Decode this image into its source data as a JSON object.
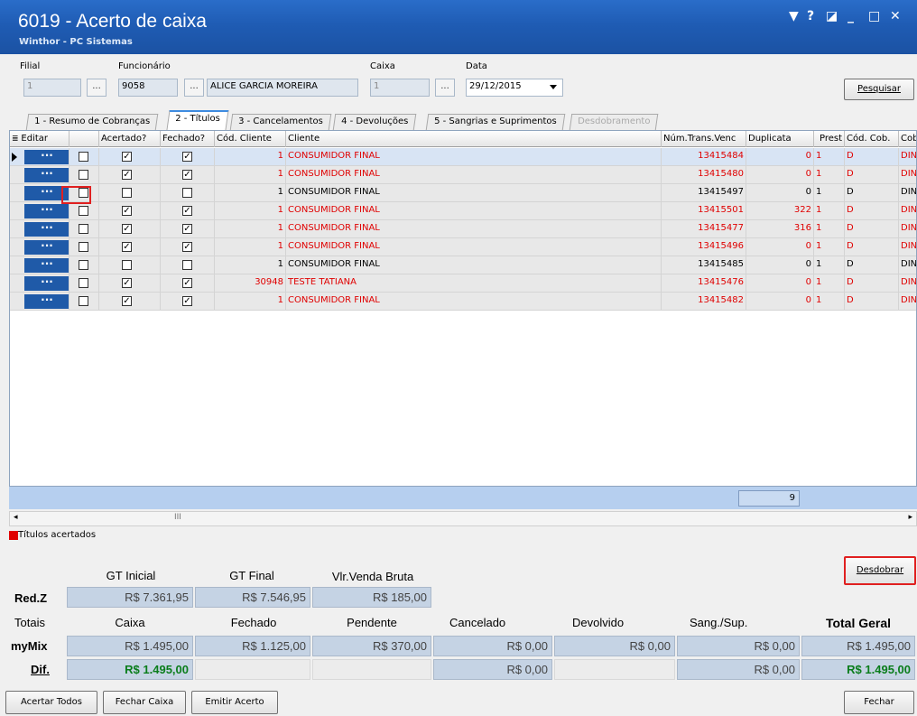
{
  "window": {
    "title": "6019 - Acerto de caixa",
    "subtitle": "Winthor - PC Sistemas",
    "controls": [
      "▼",
      "?",
      "◪",
      "_",
      "□",
      "✕"
    ]
  },
  "form": {
    "filial_label": "Filial",
    "filial_value": "1",
    "funcionario_label": "Funcionário",
    "funcionario_code": "9058",
    "funcionario_name": "ALICE GARCIA MOREIRA",
    "caixa_label": "Caixa",
    "caixa_value": "1",
    "data_label": "Data",
    "data_value": "29/12/2015",
    "ellipsis": "...",
    "pesquisar_label": "Pesquisar"
  },
  "tabs": [
    {
      "label": "1 - Resumo de Cobranças"
    },
    {
      "label": "2 - Títulos"
    },
    {
      "label": "3 - Cancelamentos"
    },
    {
      "label": "4 - Devoluções"
    },
    {
      "label": "5 - Sangrias e Suprimentos"
    },
    {
      "label": "Desdobramento"
    }
  ],
  "grid": {
    "headers": [
      "Editar",
      "",
      "Acertado?",
      "Fechado?",
      "Cód. Cliente",
      "Cliente",
      "Núm.Trans.Venc",
      "Duplicata",
      "Prest",
      "Cód. Cob.",
      "Cobr"
    ],
    "rows": [
      {
        "acertado": true,
        "fechado": true,
        "cod": "1",
        "cliente": "CONSUMIDOR FINAL",
        "num": "13415484",
        "dup": "0",
        "prest": "1",
        "codcob": "D",
        "cobr": "DINH",
        "red": true
      },
      {
        "acertado": true,
        "fechado": true,
        "cod": "1",
        "cliente": "CONSUMIDOR FINAL",
        "num": "13415480",
        "dup": "0",
        "prest": "1",
        "codcob": "D",
        "cobr": "DINH",
        "red": true
      },
      {
        "acertado": false,
        "fechado": false,
        "cod": "1",
        "cliente": "CONSUMIDOR FINAL",
        "num": "13415497",
        "dup": "0",
        "prest": "1",
        "codcob": "D",
        "cobr": "DINH",
        "red": false
      },
      {
        "acertado": true,
        "fechado": true,
        "cod": "1",
        "cliente": "CONSUMIDOR FINAL",
        "num": "13415501",
        "dup": "322",
        "prest": "1",
        "codcob": "D",
        "cobr": "DINH",
        "red": true
      },
      {
        "acertado": true,
        "fechado": true,
        "cod": "1",
        "cliente": "CONSUMIDOR FINAL",
        "num": "13415477",
        "dup": "316",
        "prest": "1",
        "codcob": "D",
        "cobr": "DINH",
        "red": true
      },
      {
        "acertado": true,
        "fechado": true,
        "cod": "1",
        "cliente": "CONSUMIDOR FINAL",
        "num": "13415496",
        "dup": "0",
        "prest": "1",
        "codcob": "D",
        "cobr": "DINH",
        "red": true
      },
      {
        "acertado": false,
        "fechado": false,
        "cod": "1",
        "cliente": "CONSUMIDOR FINAL",
        "num": "13415485",
        "dup": "0",
        "prest": "1",
        "codcob": "D",
        "cobr": "DINH",
        "red": false
      },
      {
        "acertado": true,
        "fechado": true,
        "cod": "30948",
        "cliente": "TESTE TATIANA",
        "num": "13415476",
        "dup": "0",
        "prest": "1",
        "codcob": "D",
        "cobr": "DINH",
        "red": true
      },
      {
        "acertado": true,
        "fechado": true,
        "cod": "1",
        "cliente": "CONSUMIDOR FINAL",
        "num": "13415482",
        "dup": "0",
        "prest": "1",
        "codcob": "D",
        "cobr": "DINH",
        "red": true
      }
    ],
    "edit_button": "···",
    "count": "9",
    "scroll_mark": "III"
  },
  "legend": {
    "label": "Títulos acertados",
    "color": "#e00000"
  },
  "desdobrar_label": "Desdobrar",
  "totals": {
    "gt_inicial_label": "GT Inicial",
    "gt_final_label": "GT Final",
    "vlr_venda_label": "Vlr.Venda Bruta",
    "redz_label": "Red.Z",
    "redz_gt_inicial": "R$ 7.361,95",
    "redz_gt_final": "R$ 7.546,95",
    "redz_vlr_venda": "R$ 185,00",
    "totais_label": "Totais",
    "caixa_label": "Caixa",
    "fechado_label": "Fechado",
    "pendente_label": "Pendente",
    "cancelado_label": "Cancelado",
    "devolvido_label": "Devolvido",
    "sangsup_label": "Sang./Sup.",
    "total_geral_label": "Total Geral",
    "mymix_label": "myMix",
    "mymix_caixa": "R$ 1.495,00",
    "mymix_fechado": "R$ 1.125,00",
    "mymix_pendente": "R$ 370,00",
    "mymix_cancelado": "R$ 0,00",
    "mymix_devolvido": "R$ 0,00",
    "mymix_sangsup": "R$ 0,00",
    "mymix_total": "R$ 1.495,00",
    "dif_label": "Dif.",
    "dif_caixa": "R$ 1.495,00",
    "dif_cancelado": "R$ 0,00",
    "dif_sangsup": "R$ 0,00",
    "dif_total": "R$ 1.495,00"
  },
  "bottom": {
    "acertar_todos": "Acertar Todos",
    "fechar_caixa": "Fechar Caixa",
    "emitir_acerto": "Emitir Acerto",
    "fechar": "Fechar"
  }
}
